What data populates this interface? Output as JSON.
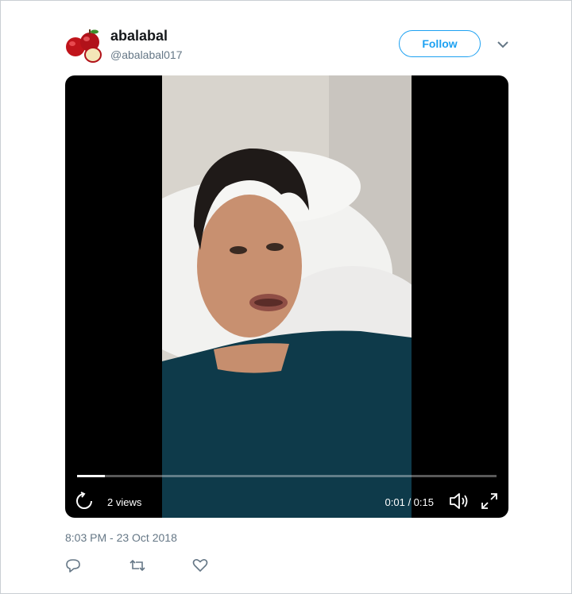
{
  "tweet": {
    "display_name": "abalabal",
    "handle": "@abalabal017",
    "follow_label": "Follow",
    "timestamp": "8:03 PM - 23 Oct 2018"
  },
  "video": {
    "views": "2 views",
    "time": "0:01 / 0:15",
    "progress": 0.067
  },
  "icons": {
    "avatar": "apple-icon",
    "caret": "chevron-down-icon",
    "replay": "replay-icon",
    "volume": "volume-icon",
    "fullscreen": "fullscreen-icon",
    "reply": "reply-icon",
    "retweet": "retweet-icon",
    "like": "heart-icon"
  },
  "colors": {
    "accent": "#1da1f2",
    "muted_text": "#657786",
    "player_bg": "#000000"
  }
}
